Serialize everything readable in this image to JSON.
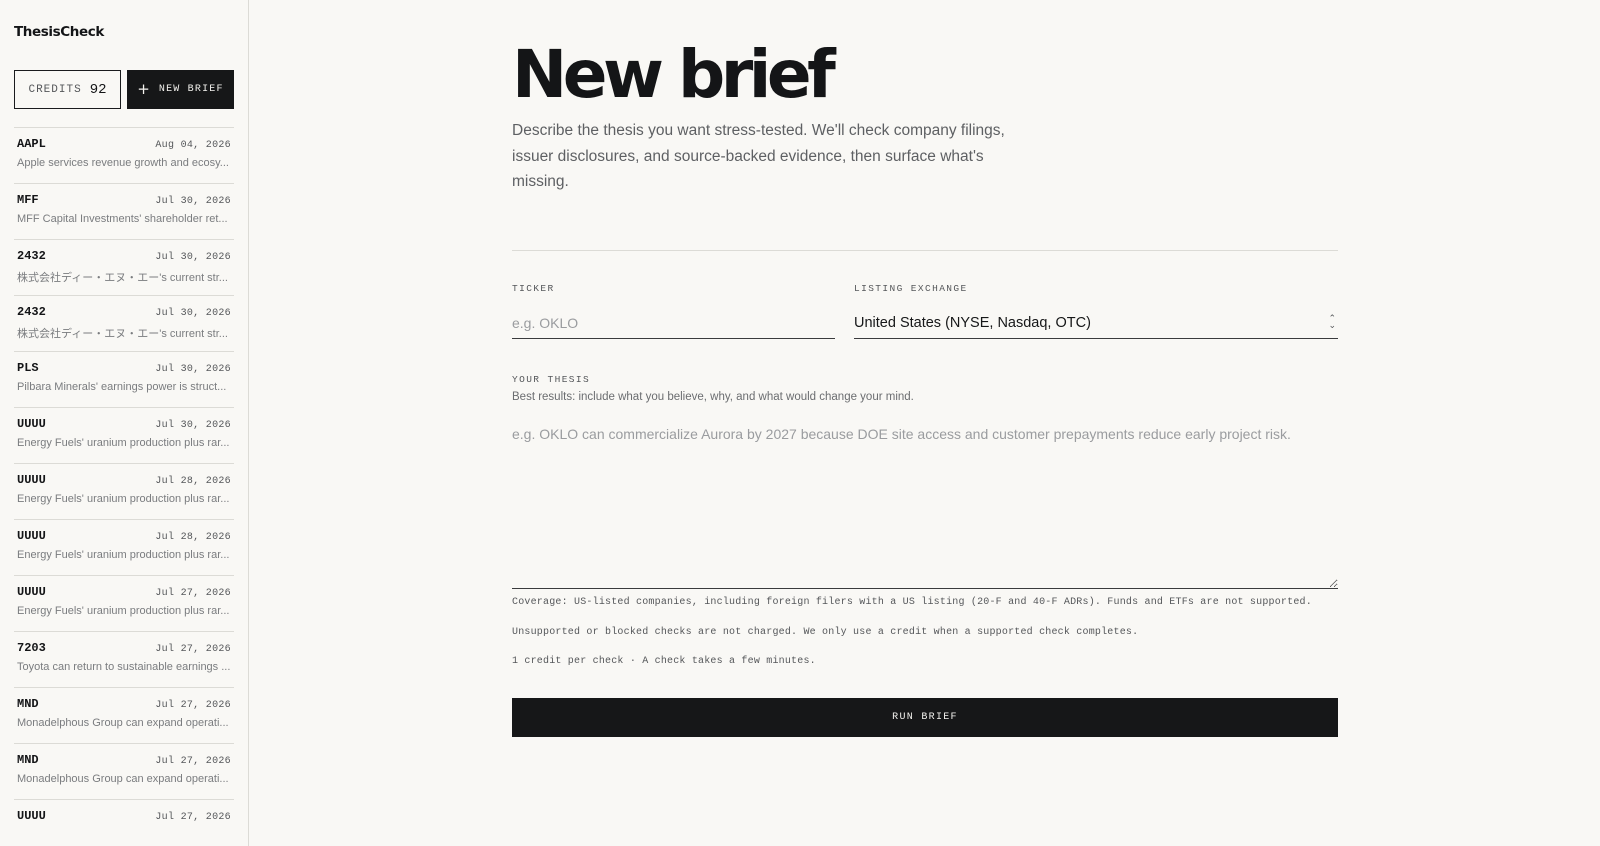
{
  "app": {
    "brand": "ThesisCheck"
  },
  "sidebar": {
    "credits_label": "CREDITS",
    "credits_value": "92",
    "new_brief_label": "NEW BRIEF",
    "history": [
      {
        "ticker": "AAPL",
        "date": "Aug 04, 2026",
        "summary": "Apple services revenue growth and ecosy..."
      },
      {
        "ticker": "MFF",
        "date": "Jul 30, 2026",
        "summary": "MFF Capital Investments' shareholder ret..."
      },
      {
        "ticker": "2432",
        "date": "Jul 30, 2026",
        "summary": "株式会社ディー・エヌ・エー's current str..."
      },
      {
        "ticker": "2432",
        "date": "Jul 30, 2026",
        "summary": "株式会社ディー・エヌ・エー's current str..."
      },
      {
        "ticker": "PLS",
        "date": "Jul 30, 2026",
        "summary": "Pilbara Minerals' earnings power is struct..."
      },
      {
        "ticker": "UUUU",
        "date": "Jul 30, 2026",
        "summary": "Energy Fuels' uranium production plus rar..."
      },
      {
        "ticker": "UUUU",
        "date": "Jul 28, 2026",
        "summary": "Energy Fuels' uranium production plus rar..."
      },
      {
        "ticker": "UUUU",
        "date": "Jul 28, 2026",
        "summary": "Energy Fuels' uranium production plus rar..."
      },
      {
        "ticker": "UUUU",
        "date": "Jul 27, 2026",
        "summary": "Energy Fuels' uranium production plus rar..."
      },
      {
        "ticker": "7203",
        "date": "Jul 27, 2026",
        "summary": "Toyota can return to sustainable earnings ..."
      },
      {
        "ticker": "MND",
        "date": "Jul 27, 2026",
        "summary": "Monadelphous Group can expand operati..."
      },
      {
        "ticker": "MND",
        "date": "Jul 27, 2026",
        "summary": "Monadelphous Group can expand operati..."
      },
      {
        "ticker": "UUUU",
        "date": "Jul 27, 2026",
        "summary": ""
      }
    ]
  },
  "main": {
    "title": "New brief",
    "description": "Describe the thesis you want stress-tested. We'll check company filings, issuer disclosures, and source-backed evidence, then surface what's missing.",
    "ticker": {
      "label": "TICKER",
      "placeholder": "e.g. OKLO",
      "value": ""
    },
    "exchange": {
      "label": "LISTING EXCHANGE",
      "value": "United States (NYSE, Nasdaq, OTC)"
    },
    "thesis": {
      "label": "YOUR THESIS",
      "helper": "Best results: include what you believe, why, and what would change your mind.",
      "placeholder": "e.g. OKLO can commercialize Aurora by 2027 because DOE site access and customer prepayments reduce early project risk.",
      "value": ""
    },
    "notes": [
      "Coverage: US-listed companies, including foreign filers with a US listing (20-F and 40-F ADRs). Funds and ETFs are not supported.",
      "Unsupported or blocked checks are not charged. We only use a credit when a supported check completes.",
      "1 credit per check · A check takes a few minutes."
    ],
    "run_label": "RUN BRIEF"
  },
  "colors": {
    "ink": "#161718",
    "background": "#f9f8f5",
    "divider": "#dcdbd6",
    "muted": "#7a7c7f"
  },
  "icons": {
    "new_brief": "plus-icon",
    "exchange_select": "chevron-updown-icon"
  }
}
